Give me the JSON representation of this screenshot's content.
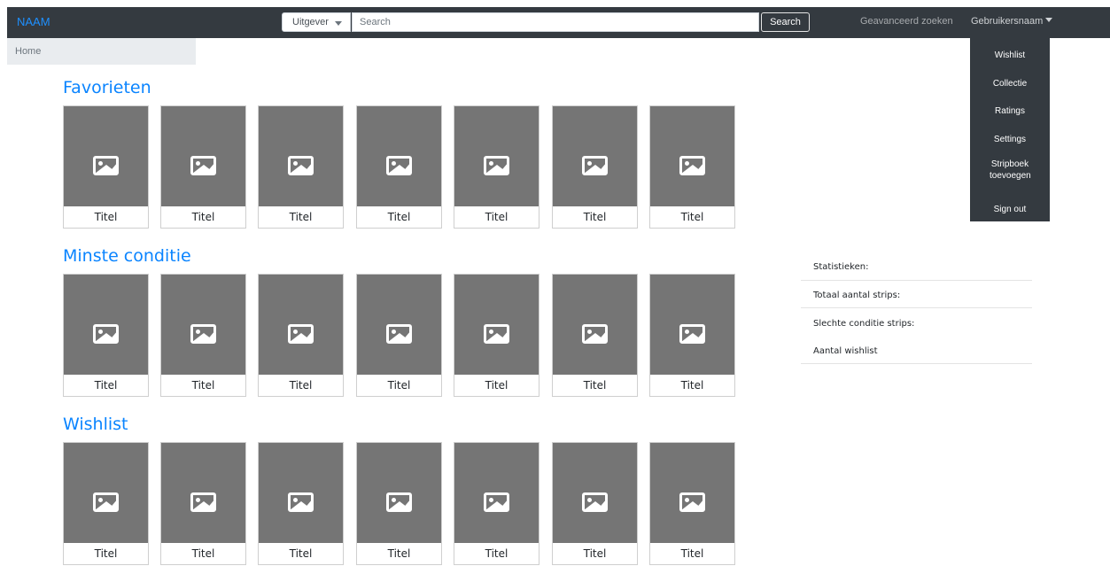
{
  "navbar": {
    "brand": "NAAM",
    "publisher_select": "Uitgever",
    "search_placeholder": "Search",
    "search_button": "Search",
    "advanced_search": "Geavanceerd zoeken",
    "username": "Gebruikersnaam"
  },
  "breadcrumb": {
    "home": "Home"
  },
  "user_menu": [
    "Wishlist",
    "Collectie",
    "Ratings",
    "Settings",
    "Stripboek toevoegen",
    "Sign out"
  ],
  "sections": [
    {
      "title": "Favorieten",
      "items": [
        "Titel",
        "Titel",
        "Titel",
        "Titel",
        "Titel",
        "Titel",
        "Titel"
      ]
    },
    {
      "title": "Minste conditie",
      "items": [
        "Titel",
        "Titel",
        "Titel",
        "Titel",
        "Titel",
        "Titel",
        "Titel"
      ]
    },
    {
      "title": "Wishlist",
      "items": [
        "Titel",
        "Titel",
        "Titel",
        "Titel",
        "Titel",
        "Titel",
        "Titel"
      ]
    }
  ],
  "stats": {
    "heading": "Statistieken:",
    "total": "Totaal aantal strips:",
    "bad_condition": "Slechte conditie strips:",
    "wishlist_count": "Aantal wishlist"
  },
  "colors": {
    "navbar": "#343a40",
    "brand": "#1e90ff",
    "section_title": "#0a84ff",
    "placeholder_image": "#757575"
  },
  "icons": {
    "cover_placeholder": "image-icon",
    "dropdown": "caret-down-icon"
  }
}
